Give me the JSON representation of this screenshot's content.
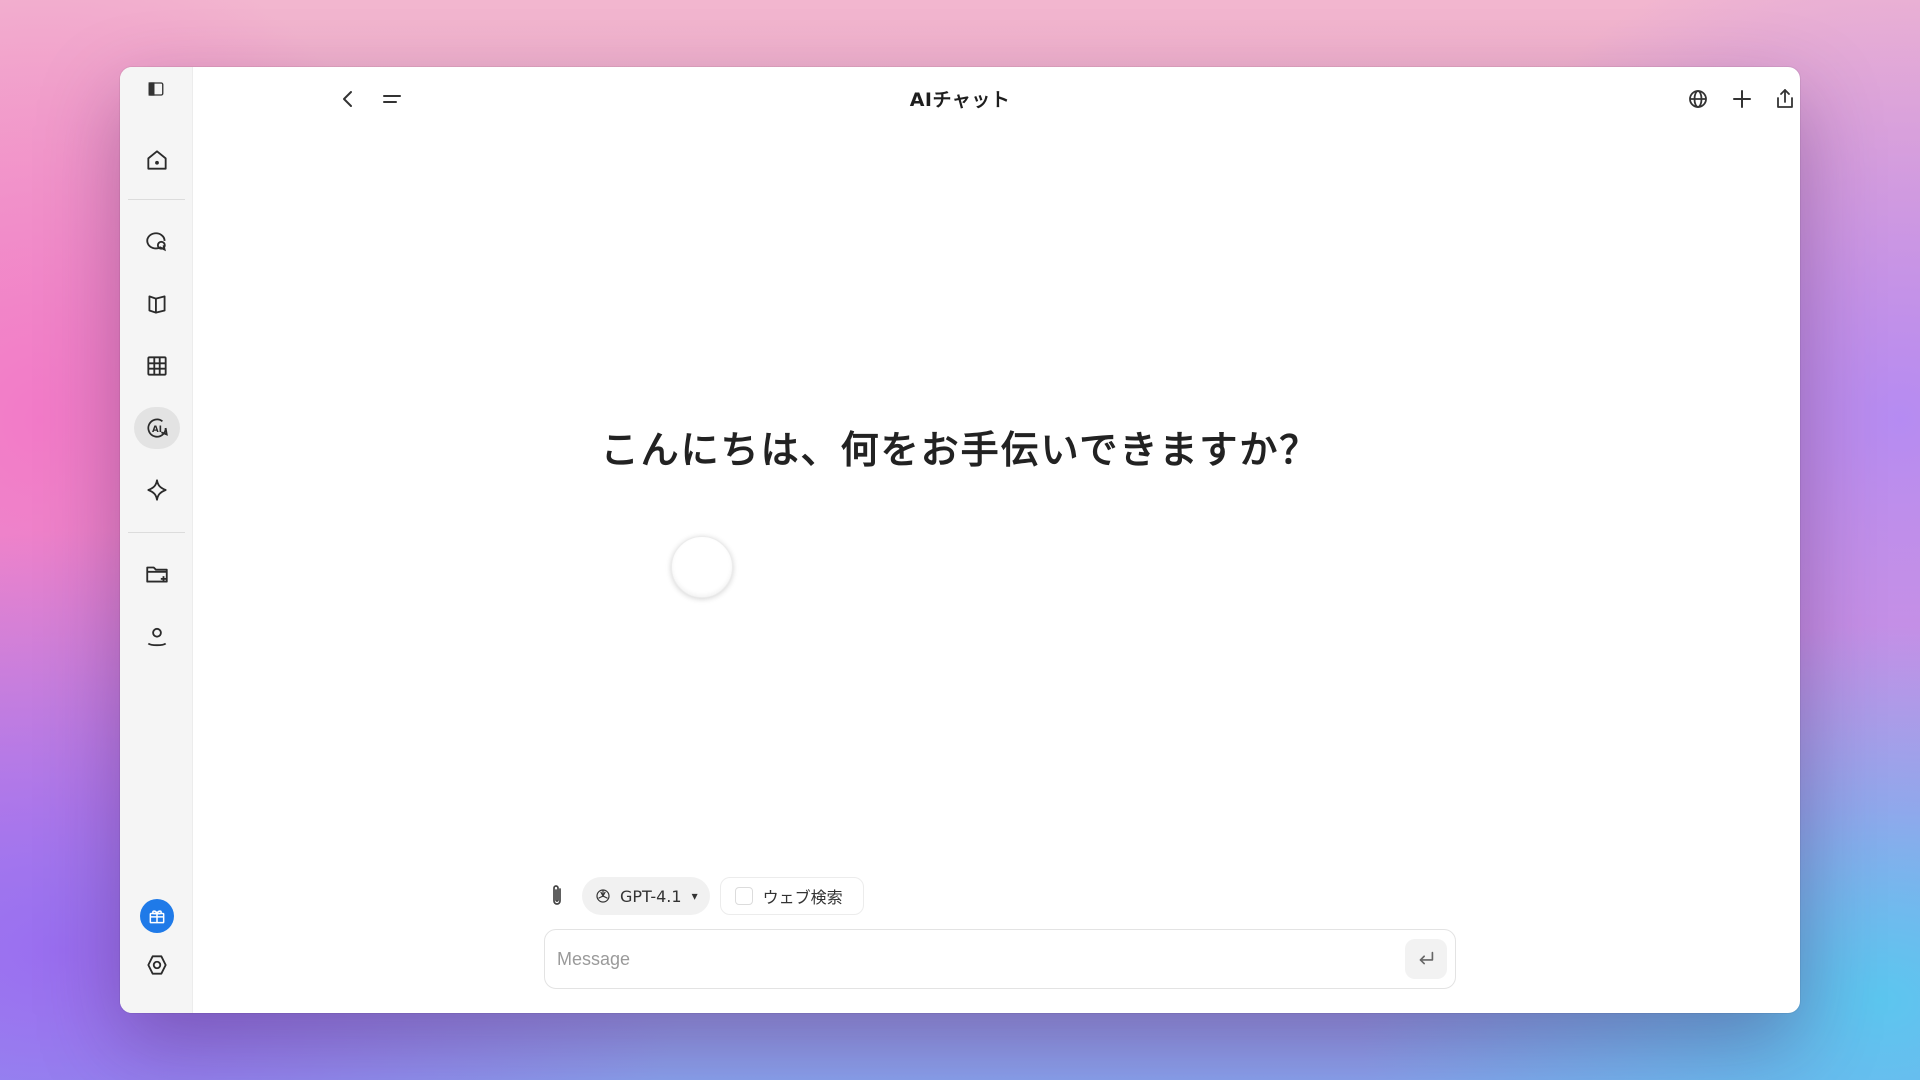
{
  "window": {
    "title": "AIチャット"
  },
  "topbar": {
    "icons": [
      "sidebar-toggle-icon",
      "back-icon",
      "menu-icon",
      "globe-icon",
      "plus-icon",
      "share-icon"
    ]
  },
  "sidebar": {
    "items": [
      {
        "name": "home",
        "icon": "home-icon",
        "active": false
      },
      {
        "name": "chat",
        "icon": "chat-bubble-icon",
        "active": false
      },
      {
        "name": "book",
        "icon": "book-icon",
        "active": false
      },
      {
        "name": "table",
        "icon": "grid-table-icon",
        "active": false
      },
      {
        "name": "ai-chat",
        "icon": "ai-icon",
        "active": true
      },
      {
        "name": "sparkle",
        "icon": "sparkle-icon",
        "active": false
      },
      {
        "name": "folder",
        "icon": "folder-add-icon",
        "active": false
      },
      {
        "name": "user",
        "icon": "user-icon",
        "active": false
      }
    ],
    "bottom": [
      "gift-icon",
      "settings-icon"
    ],
    "accent_color": "#1f7ae8"
  },
  "main": {
    "greeting": "こんにちは、何をお手伝いできますか？"
  },
  "composer": {
    "model_label": "GPT-4.1",
    "model_caret": "▾",
    "web_search_label": "ウェブ検索",
    "web_search_checked": false,
    "placeholder": "Message"
  }
}
